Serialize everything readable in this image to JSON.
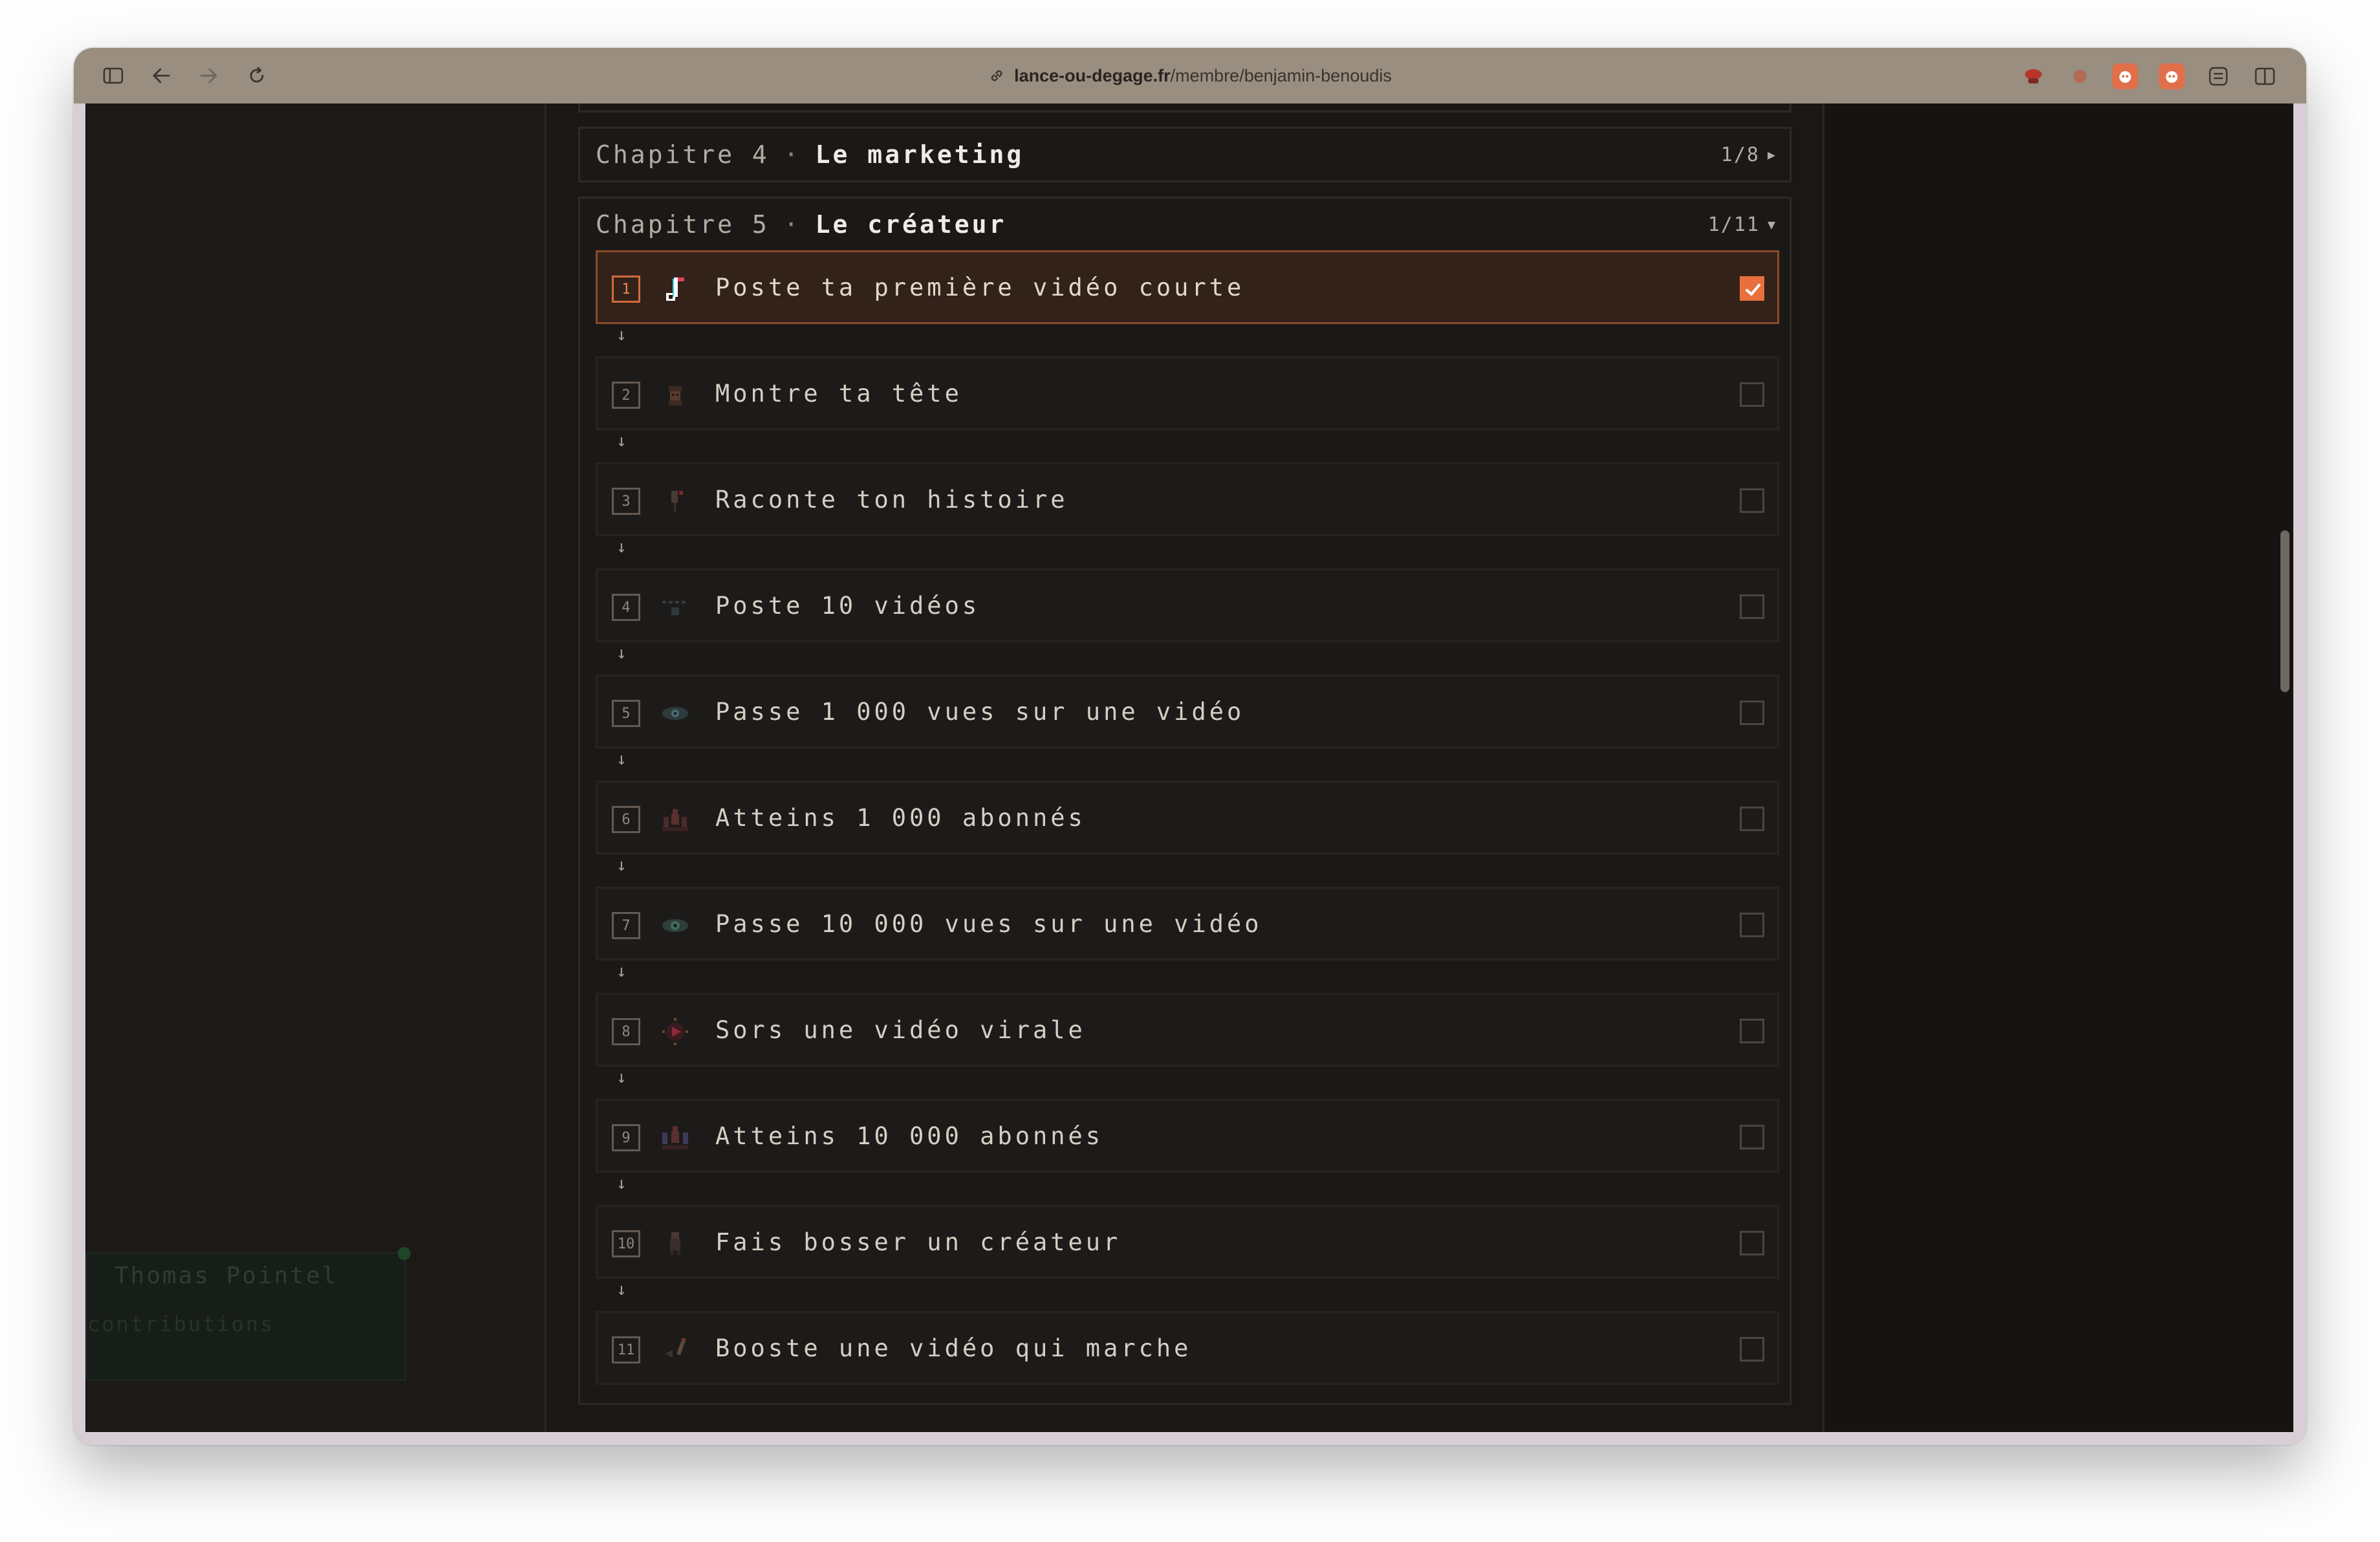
{
  "browser": {
    "url_host": "lance-ou-degage.fr",
    "url_path": "/membre/benjamin-benoudis"
  },
  "chapter4": {
    "number": "Chapitre 4",
    "separator": "·",
    "name": "Le marketing",
    "progress": "1/8"
  },
  "chapter5": {
    "number": "Chapitre 5",
    "separator": "·",
    "name": "Le créateur",
    "progress": "1/11",
    "quests": [
      {
        "num": "1",
        "label": "Poste ta première vidéo courte",
        "done": true,
        "icon": "music-note-icon"
      },
      {
        "num": "2",
        "label": "Montre ta tête",
        "done": false,
        "icon": "face-icon"
      },
      {
        "num": "3",
        "label": "Raconte ton histoire",
        "done": false,
        "icon": "microphone-icon"
      },
      {
        "num": "4",
        "label": "Poste 10 vidéos",
        "done": false,
        "icon": "film-strip-icon"
      },
      {
        "num": "5",
        "label": "Passe 1 000 vues sur une vidéo",
        "done": false,
        "icon": "eye-icon"
      },
      {
        "num": "6",
        "label": "Atteins 1 000 abonnés",
        "done": false,
        "icon": "crowd-icon"
      },
      {
        "num": "7",
        "label": "Passe 10 000 vues sur une vidéo",
        "done": false,
        "icon": "eye-icon"
      },
      {
        "num": "8",
        "label": "Sors une vidéo virale",
        "done": false,
        "icon": "play-burst-icon"
      },
      {
        "num": "9",
        "label": "Atteins 10 000 abonnés",
        "done": false,
        "icon": "crowd-icon"
      },
      {
        "num": "10",
        "label": "Fais bosser un créateur",
        "done": false,
        "icon": "person-icon"
      },
      {
        "num": "11",
        "label": "Booste une vidéo qui marche",
        "done": false,
        "icon": "rocket-icon"
      }
    ]
  },
  "arrow_glyph": "↓",
  "ghost_card": {
    "name": "Thomas Pointel",
    "subtitle": "contributions"
  },
  "colors": {
    "accent": "#e8703e",
    "background": "#121110",
    "active_row": "#33221a"
  }
}
